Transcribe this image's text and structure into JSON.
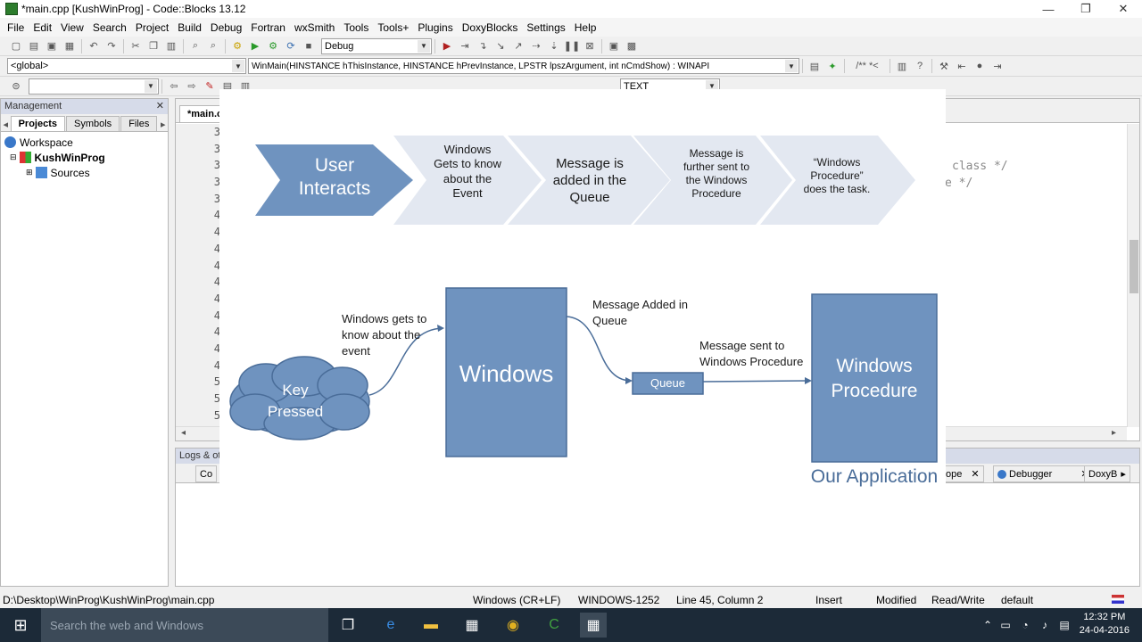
{
  "window": {
    "title": "*main.cpp [KushWinProg] - Code::Blocks 13.12",
    "minimize": "—",
    "maximize": "❐",
    "close": "✕"
  },
  "menu": [
    "File",
    "Edit",
    "View",
    "Search",
    "Project",
    "Build",
    "Debug",
    "Fortran",
    "wxSmith",
    "Tools",
    "Tools+",
    "Plugins",
    "DoxyBlocks",
    "Settings",
    "Help"
  ],
  "toolbar": {
    "build_target": "Debug",
    "scope": "<global>",
    "function": "WinMain(HINSTANCE hThisInstance, HINSTANCE hPrevInstance, LPSTR lpszArgument, int nCmdShow) : WINAPI",
    "comment_btn": "/** *<",
    "search_value": "",
    "text_combo": "TEXT"
  },
  "management": {
    "header": "Management",
    "close": "✕",
    "tabs": [
      "Projects",
      "Symbols",
      "Files"
    ],
    "tree": {
      "workspace": "Workspace",
      "project": "KushWinProg",
      "folder": "Sources"
    }
  },
  "editor": {
    "tab": "*main.c",
    "gutter": [
      "3",
      "3",
      "3",
      "3",
      "3",
      "4",
      "4",
      "4",
      "4",
      "4",
      "4",
      "4",
      "4",
      "4",
      "4",
      "5",
      "5",
      "5"
    ],
    "code_right1": "class */",
    "code_right2": "e */"
  },
  "logs": {
    "header": "Logs & others",
    "tabs": {
      "t1": "Co",
      "t2": "ope",
      "t3": "Debugger",
      "t4": "DoxyB"
    }
  },
  "diagram": {
    "chevrons": [
      {
        "text": "User Interacts"
      },
      {
        "text": "Windows Gets to know about the Event"
      },
      {
        "text": "Message is added in the Queue"
      },
      {
        "text": "Message is further sent to the Windows Procedure"
      },
      {
        "text": "“Windows Procedure” does the task."
      }
    ],
    "cloud_text": "Key Pressed",
    "label_know": "Windows gets to know about the event",
    "windows_box": "Windows",
    "label_added": "Message Added in Queue",
    "queue_box": "Queue",
    "label_sent": "Message sent to Windows Procedure",
    "proc_box": "Windows Procedure",
    "app_label": "Our Application"
  },
  "status": {
    "path": "D:\\Desktop\\WinProg\\KushWinProg\\main.cpp",
    "eol": "Windows (CR+LF)",
    "encoding": "WINDOWS-1252",
    "position": "Line 45, Column 2",
    "mode": "Insert",
    "modified": "Modified",
    "rw": "Read/Write",
    "profile": "default"
  },
  "taskbar": {
    "search": "Search the web and Windows",
    "time": "12:32 PM",
    "date": "24-04-2016"
  },
  "colors": {
    "accent_fill": "#6f93bf",
    "box_border": "#4a6d99",
    "chevron_light": "#e3e8f1"
  }
}
